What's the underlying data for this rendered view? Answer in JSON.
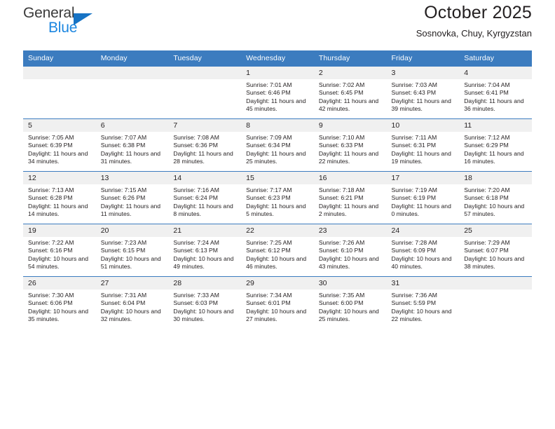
{
  "brand": {
    "name_part1": "General",
    "name_part2": "Blue",
    "triangle_color": "#1773c4",
    "blue_color": "#1b86e0"
  },
  "header": {
    "title": "October 2025",
    "subtitle": "Sosnovka, Chuy, Kyrgyzstan"
  },
  "theme": {
    "header_row_bg": "#3c7cbf",
    "day_number_bg": "#f0f0f0",
    "grid_line": "#3c7cbf",
    "text": "#231f20"
  },
  "calendar": {
    "weekday_headers": [
      "Sunday",
      "Monday",
      "Tuesday",
      "Wednesday",
      "Thursday",
      "Friday",
      "Saturday"
    ],
    "labels": {
      "sunrise_prefix": "Sunrise:",
      "sunset_prefix": "Sunset:",
      "daylight_prefix": "Daylight:"
    },
    "weeks": [
      [
        {
          "day": "",
          "empty": true
        },
        {
          "day": "",
          "empty": true
        },
        {
          "day": "",
          "empty": true
        },
        {
          "day": "1",
          "sunrise": "Sunrise: 7:01 AM",
          "sunset": "Sunset: 6:46 PM",
          "daylight": "Daylight: 11 hours and 45 minutes."
        },
        {
          "day": "2",
          "sunrise": "Sunrise: 7:02 AM",
          "sunset": "Sunset: 6:45 PM",
          "daylight": "Daylight: 11 hours and 42 minutes."
        },
        {
          "day": "3",
          "sunrise": "Sunrise: 7:03 AM",
          "sunset": "Sunset: 6:43 PM",
          "daylight": "Daylight: 11 hours and 39 minutes."
        },
        {
          "day": "4",
          "sunrise": "Sunrise: 7:04 AM",
          "sunset": "Sunset: 6:41 PM",
          "daylight": "Daylight: 11 hours and 36 minutes."
        }
      ],
      [
        {
          "day": "5",
          "sunrise": "Sunrise: 7:05 AM",
          "sunset": "Sunset: 6:39 PM",
          "daylight": "Daylight: 11 hours and 34 minutes."
        },
        {
          "day": "6",
          "sunrise": "Sunrise: 7:07 AM",
          "sunset": "Sunset: 6:38 PM",
          "daylight": "Daylight: 11 hours and 31 minutes."
        },
        {
          "day": "7",
          "sunrise": "Sunrise: 7:08 AM",
          "sunset": "Sunset: 6:36 PM",
          "daylight": "Daylight: 11 hours and 28 minutes."
        },
        {
          "day": "8",
          "sunrise": "Sunrise: 7:09 AM",
          "sunset": "Sunset: 6:34 PM",
          "daylight": "Daylight: 11 hours and 25 minutes."
        },
        {
          "day": "9",
          "sunrise": "Sunrise: 7:10 AM",
          "sunset": "Sunset: 6:33 PM",
          "daylight": "Daylight: 11 hours and 22 minutes."
        },
        {
          "day": "10",
          "sunrise": "Sunrise: 7:11 AM",
          "sunset": "Sunset: 6:31 PM",
          "daylight": "Daylight: 11 hours and 19 minutes."
        },
        {
          "day": "11",
          "sunrise": "Sunrise: 7:12 AM",
          "sunset": "Sunset: 6:29 PM",
          "daylight": "Daylight: 11 hours and 16 minutes."
        }
      ],
      [
        {
          "day": "12",
          "sunrise": "Sunrise: 7:13 AM",
          "sunset": "Sunset: 6:28 PM",
          "daylight": "Daylight: 11 hours and 14 minutes."
        },
        {
          "day": "13",
          "sunrise": "Sunrise: 7:15 AM",
          "sunset": "Sunset: 6:26 PM",
          "daylight": "Daylight: 11 hours and 11 minutes."
        },
        {
          "day": "14",
          "sunrise": "Sunrise: 7:16 AM",
          "sunset": "Sunset: 6:24 PM",
          "daylight": "Daylight: 11 hours and 8 minutes."
        },
        {
          "day": "15",
          "sunrise": "Sunrise: 7:17 AM",
          "sunset": "Sunset: 6:23 PM",
          "daylight": "Daylight: 11 hours and 5 minutes."
        },
        {
          "day": "16",
          "sunrise": "Sunrise: 7:18 AM",
          "sunset": "Sunset: 6:21 PM",
          "daylight": "Daylight: 11 hours and 2 minutes."
        },
        {
          "day": "17",
          "sunrise": "Sunrise: 7:19 AM",
          "sunset": "Sunset: 6:19 PM",
          "daylight": "Daylight: 11 hours and 0 minutes."
        },
        {
          "day": "18",
          "sunrise": "Sunrise: 7:20 AM",
          "sunset": "Sunset: 6:18 PM",
          "daylight": "Daylight: 10 hours and 57 minutes."
        }
      ],
      [
        {
          "day": "19",
          "sunrise": "Sunrise: 7:22 AM",
          "sunset": "Sunset: 6:16 PM",
          "daylight": "Daylight: 10 hours and 54 minutes."
        },
        {
          "day": "20",
          "sunrise": "Sunrise: 7:23 AM",
          "sunset": "Sunset: 6:15 PM",
          "daylight": "Daylight: 10 hours and 51 minutes."
        },
        {
          "day": "21",
          "sunrise": "Sunrise: 7:24 AM",
          "sunset": "Sunset: 6:13 PM",
          "daylight": "Daylight: 10 hours and 49 minutes."
        },
        {
          "day": "22",
          "sunrise": "Sunrise: 7:25 AM",
          "sunset": "Sunset: 6:12 PM",
          "daylight": "Daylight: 10 hours and 46 minutes."
        },
        {
          "day": "23",
          "sunrise": "Sunrise: 7:26 AM",
          "sunset": "Sunset: 6:10 PM",
          "daylight": "Daylight: 10 hours and 43 minutes."
        },
        {
          "day": "24",
          "sunrise": "Sunrise: 7:28 AM",
          "sunset": "Sunset: 6:09 PM",
          "daylight": "Daylight: 10 hours and 40 minutes."
        },
        {
          "day": "25",
          "sunrise": "Sunrise: 7:29 AM",
          "sunset": "Sunset: 6:07 PM",
          "daylight": "Daylight: 10 hours and 38 minutes."
        }
      ],
      [
        {
          "day": "26",
          "sunrise": "Sunrise: 7:30 AM",
          "sunset": "Sunset: 6:06 PM",
          "daylight": "Daylight: 10 hours and 35 minutes."
        },
        {
          "day": "27",
          "sunrise": "Sunrise: 7:31 AM",
          "sunset": "Sunset: 6:04 PM",
          "daylight": "Daylight: 10 hours and 32 minutes."
        },
        {
          "day": "28",
          "sunrise": "Sunrise: 7:33 AM",
          "sunset": "Sunset: 6:03 PM",
          "daylight": "Daylight: 10 hours and 30 minutes."
        },
        {
          "day": "29",
          "sunrise": "Sunrise: 7:34 AM",
          "sunset": "Sunset: 6:01 PM",
          "daylight": "Daylight: 10 hours and 27 minutes."
        },
        {
          "day": "30",
          "sunrise": "Sunrise: 7:35 AM",
          "sunset": "Sunset: 6:00 PM",
          "daylight": "Daylight: 10 hours and 25 minutes."
        },
        {
          "day": "31",
          "sunrise": "Sunrise: 7:36 AM",
          "sunset": "Sunset: 5:59 PM",
          "daylight": "Daylight: 10 hours and 22 minutes."
        },
        {
          "day": "",
          "empty": true
        }
      ]
    ]
  }
}
